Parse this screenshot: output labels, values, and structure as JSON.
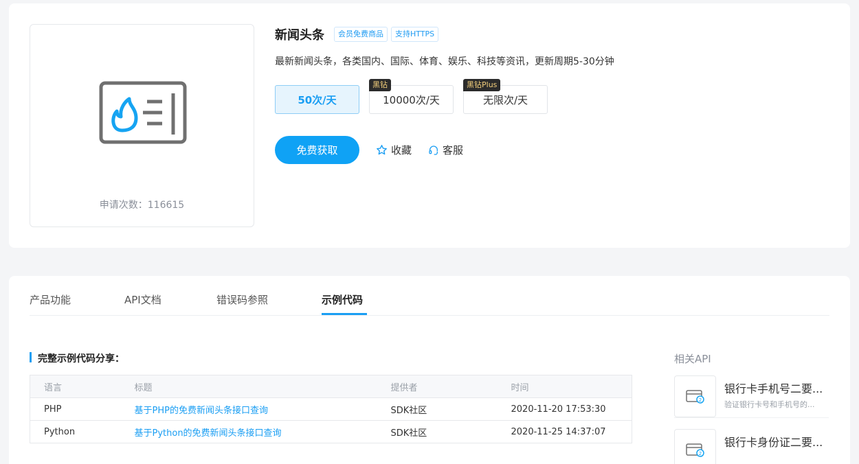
{
  "product": {
    "title": "新闻头条",
    "tags": [
      "会员免费商品",
      "支持HTTPS"
    ],
    "description": "最新新闻头条，各类国内、国际、体育、娱乐、科技等资讯，更新周期5-30分钟",
    "apply_count_label": "申请次数：116615",
    "plans": [
      {
        "label": "50次/天",
        "badge": "",
        "selected": true
      },
      {
        "label": "10000次/天",
        "badge": "黑钻",
        "selected": false
      },
      {
        "label": "无限次/天",
        "badge": "黑钻Plus",
        "selected": false
      }
    ],
    "get_button": "免费获取",
    "favorite_label": "收藏",
    "service_label": "客服"
  },
  "tabs": [
    {
      "label": "产品功能",
      "active": false
    },
    {
      "label": "API文档",
      "active": false
    },
    {
      "label": "错误码参照",
      "active": false
    },
    {
      "label": "示例代码",
      "active": true
    }
  ],
  "code_share": {
    "section_title": "完整示例代码分享：",
    "columns": [
      "语言",
      "标题",
      "提供者",
      "时间"
    ],
    "rows": [
      {
        "language": "PHP",
        "title": "基于PHP的免费新闻头条接口查询",
        "provider": "SDK社区",
        "time": "2020-11-20 17:53:30"
      },
      {
        "language": "Python",
        "title": "基于Python的免费新闻头条接口查询",
        "provider": "SDK社区",
        "time": "2020-11-25 14:37:07"
      }
    ]
  },
  "related": {
    "title": "相关API",
    "items": [
      {
        "name": "银行卡手机号二要...",
        "desc": "验证银行卡号和手机号的..."
      },
      {
        "name": "银行卡身份证二要...",
        "desc": ""
      }
    ]
  },
  "colors": {
    "accent": "#1a9ef3",
    "badge_bg": "#2b2b2b",
    "badge_text": "#f3cf7b"
  }
}
